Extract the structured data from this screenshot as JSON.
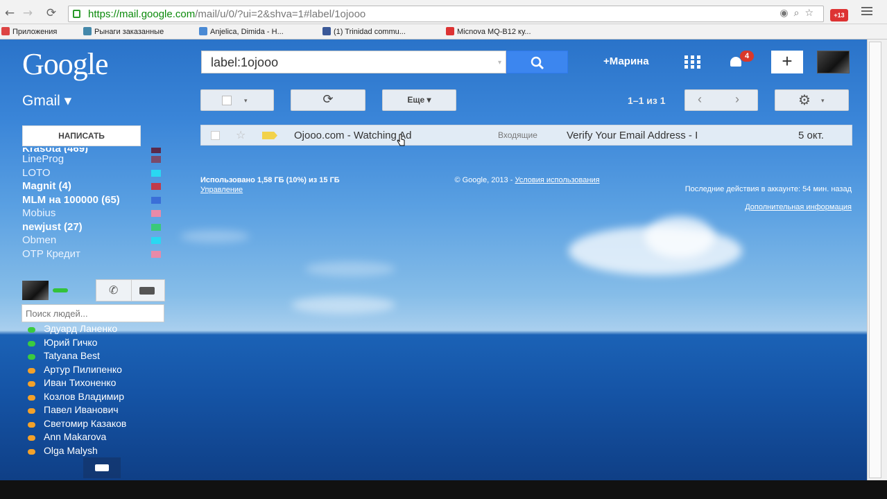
{
  "browser": {
    "url_https": "https://mail.google.com",
    "url_rest": "/mail/u/0/?ui=2&shva=1#label/1ojooo",
    "extension_badge": "+13",
    "bookmarks": [
      {
        "label": "Приложения",
        "color": "#d44"
      },
      {
        "label": "Рынаги заказанные",
        "color": "#48a"
      },
      {
        "label": "Anjelica, Dimida - H...",
        "color": "#4a8ad4"
      },
      {
        "label": "(1) Trinidad commu...",
        "color": "#3b5998"
      },
      {
        "label": "Micnova MQ-B12 ку...",
        "color": "#d33"
      }
    ]
  },
  "header": {
    "logo": "Google",
    "search_value": "label:1ojooo",
    "user": "+Марина",
    "notification_count": "4",
    "plus_label": "+"
  },
  "toolbar": {
    "gmail_label": "Gmail ▾",
    "more_label": "Еще ▾",
    "pager": "1–1 из 1",
    "refresh_icon": "⟳"
  },
  "sidebar": {
    "compose": "НАПИСАТЬ",
    "labels": [
      {
        "name": "Krasota (469)",
        "bold": true,
        "color": "#5a2a4a"
      },
      {
        "name": "LineProg",
        "bold": false,
        "color": "#7a4a6a"
      },
      {
        "name": "LOTO",
        "bold": false,
        "color": "#2ad8f2"
      },
      {
        "name": "Magnit (4)",
        "bold": true,
        "color": "#c23a4a"
      },
      {
        "name": "MLM на 100000 (65)",
        "bold": true,
        "color": "#3a6fd8"
      },
      {
        "name": "Mobius",
        "bold": false,
        "color": "#e88aa8"
      },
      {
        "name": "newjust (27)",
        "bold": true,
        "color": "#3ac97a"
      },
      {
        "name": "Obmen",
        "bold": false,
        "color": "#2ad8f2"
      },
      {
        "name": "OTP Кредит",
        "bold": false,
        "color": "#e88aa8"
      }
    ],
    "people_search_placeholder": "Поиск людей...",
    "contacts": [
      {
        "name": "Эдуард Ланенко",
        "status": "green"
      },
      {
        "name": "Юрий Гичко",
        "status": "green"
      },
      {
        "name": "Tatyana Best",
        "status": "green"
      },
      {
        "name": "Артур Пилипенко",
        "status": "orange"
      },
      {
        "name": "Иван Тихоненко",
        "status": "orange"
      },
      {
        "name": "Козлов Владимир",
        "status": "orange"
      },
      {
        "name": "Павел Иванович",
        "status": "orange"
      },
      {
        "name": "Светомир Казаков",
        "status": "orange"
      },
      {
        "name": "Ann Makarova",
        "status": "orange"
      },
      {
        "name": "Olga Malysh",
        "status": "orange"
      }
    ]
  },
  "mail": {
    "sender": "Ojooo.com - Watching Ad",
    "tag": "Входящие",
    "subject": "Verify Your Email Address - I",
    "date": "5 окт."
  },
  "footer": {
    "used": "Использовано 1,58 ГБ (10%) из 15 ГБ",
    "manage": "Управление",
    "copyright": "© Google, 2013 - ",
    "terms": "Условия использования",
    "activity": "Последние действия в аккаунте: 54 мин. назад",
    "details": "Дополнительная информация"
  }
}
